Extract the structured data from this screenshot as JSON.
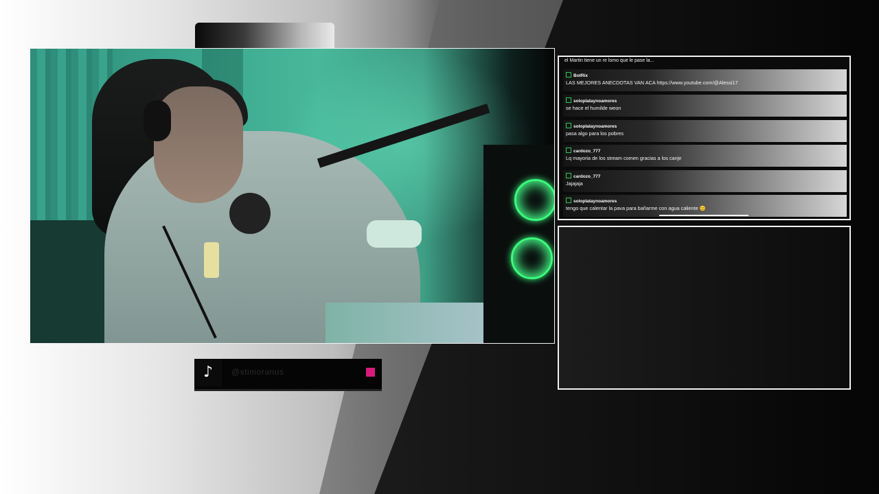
{
  "overlay": {
    "social": {
      "icon": "tiktok-icon",
      "handle": "@stimoranus",
      "accent": "#d81b7a"
    }
  },
  "chat": {
    "cutoff_top": "el Martin tiene un re lomo que le pase la...",
    "messages": [
      {
        "user": "BotRix",
        "text": "LAS MEJORES ANECDOTAS VAN ACA https://www.youtube.com/@Alessi17"
      },
      {
        "user": "soloplataynoamores",
        "text": "se hace el humilde weon"
      },
      {
        "user": "soloplataynoamores",
        "text": "pasa algo para los pobres"
      },
      {
        "user": "cardozo_777",
        "text": "Lq mayoria de los stream comen gracias a los canje"
      },
      {
        "user": "cardozo_777",
        "text": "Jajajaja"
      },
      {
        "user": "soloplataynoamores",
        "text": "tengo que calentar la pava para bañarme con agua caliente 😊"
      }
    ]
  },
  "colors": {
    "badge_green": "#34c759",
    "frame": "#f2f2f2"
  }
}
